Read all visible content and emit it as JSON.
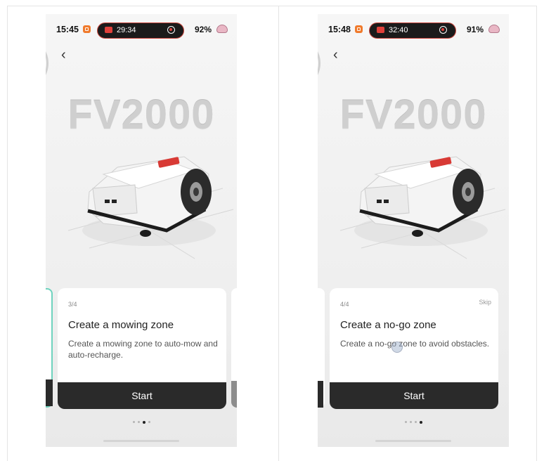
{
  "screens": [
    {
      "status": {
        "time": "15:45",
        "recording_time": "29:34",
        "battery": "92%"
      },
      "model_name": "FV2000",
      "card": {
        "step": "3/4",
        "skip": "",
        "title": "Create a mowing zone",
        "description": "Create a mowing zone to auto-mow and auto-recharge.",
        "button": "Start"
      },
      "page_indicator": {
        "count": 4,
        "active_index": 2
      }
    },
    {
      "status": {
        "time": "15:48",
        "recording_time": "32:40",
        "battery": "91%"
      },
      "model_name": "FV2000",
      "card": {
        "step": "4/4",
        "skip": "Skip",
        "title": "Create a no-go zone",
        "description": "Create a no-go zone to avoid obstacles.",
        "button": "Start"
      },
      "page_indicator": {
        "count": 4,
        "active_index": 3
      }
    }
  ],
  "colors": {
    "accent_teal": "#6fd3be",
    "button_dark": "#2a2a2a",
    "record_red": "#e0403a",
    "mower_accent": "#d83a35"
  },
  "icons": {
    "back": "chevron-left-icon",
    "app_badge": "app-badge-icon",
    "record": "record-icon",
    "battery": "battery-icon"
  }
}
